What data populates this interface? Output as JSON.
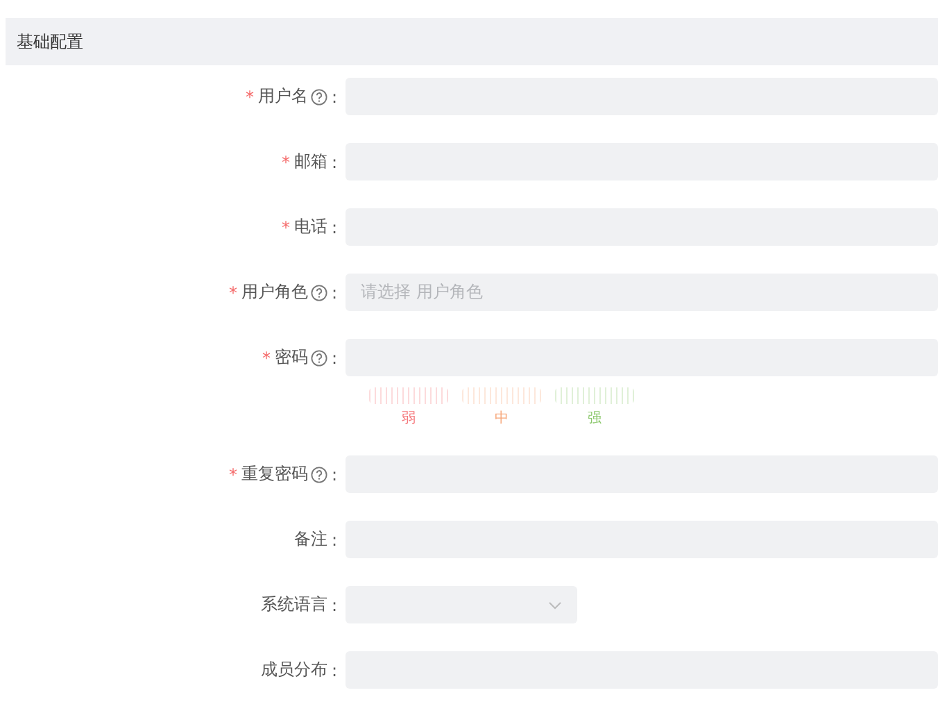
{
  "section": {
    "title": "基础配置"
  },
  "fields": [
    {
      "kind": "input",
      "required_mark": "*",
      "label": "用户名",
      "help": true,
      "colon": ":"
    },
    {
      "kind": "input",
      "required_mark": "*",
      "label": "邮箱",
      "help": false,
      "colon": ":"
    },
    {
      "kind": "input",
      "required_mark": "*",
      "label": "电话",
      "help": false,
      "colon": ":"
    },
    {
      "kind": "select",
      "required_mark": "*",
      "label": "用户角色",
      "help": true,
      "colon": ":",
      "placeholder": "请选择 用户角色"
    },
    {
      "kind": "password",
      "required_mark": "*",
      "label": "密码",
      "help": true,
      "colon": ":",
      "strength": [
        {
          "label": "弱",
          "color": "#f5777b"
        },
        {
          "label": "中",
          "color": "#f7a77a"
        },
        {
          "label": "强",
          "color": "#8ac76b"
        }
      ]
    },
    {
      "kind": "input",
      "required_mark": "*",
      "label": "重复密码",
      "help": true,
      "colon": ":"
    },
    {
      "kind": "input",
      "label": "备注",
      "help": false,
      "colon": ":"
    },
    {
      "kind": "short-select",
      "label": "系统语言",
      "help": false,
      "colon": ":"
    },
    {
      "kind": "input",
      "label": "成员分布",
      "help": false,
      "colon": ":"
    }
  ]
}
